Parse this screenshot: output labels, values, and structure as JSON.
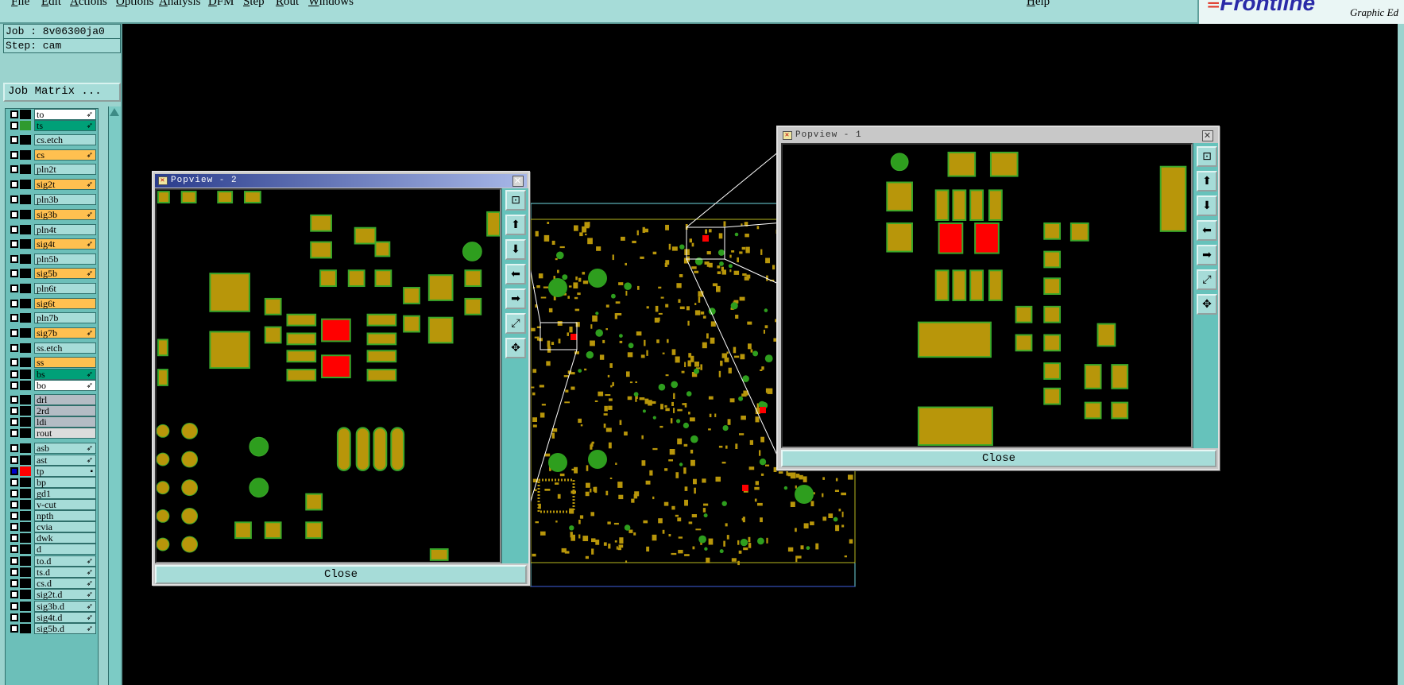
{
  "menu": [
    "File",
    "Edit",
    "Actions",
    "Options",
    "Analysis",
    "DFM",
    "Step",
    "Rout",
    "Windows"
  ],
  "menu_help": "Help",
  "logo": {
    "text": "Frontline",
    "sub": "Graphic Ed"
  },
  "job": {
    "job_line": "Job : 8v06300ja0",
    "step_line": "Step: cam"
  },
  "job_matrix_label": "Job Matrix ...",
  "layers": [
    {
      "name": "to",
      "color": "#ffffff",
      "has_arrow": true
    },
    {
      "name": "ts",
      "color": "#00a078",
      "has_arrow": true
    },
    {
      "name": "cs.etch",
      "color": "#a6dcd8",
      "has_arrow": false
    },
    {
      "name": "cs",
      "color": "#ffc050",
      "has_arrow": true
    },
    {
      "name": "pln2t",
      "color": "#a6dcd8",
      "has_arrow": false
    },
    {
      "name": "sig2t",
      "color": "#ffc050",
      "has_arrow": true
    },
    {
      "name": "pln3b",
      "color": "#a6dcd8",
      "has_arrow": false
    },
    {
      "name": "sig3b",
      "color": "#ffc050",
      "has_arrow": true
    },
    {
      "name": "pln4t",
      "color": "#a6dcd8",
      "has_arrow": false
    },
    {
      "name": "sig4t",
      "color": "#ffc050",
      "has_arrow": true
    },
    {
      "name": "pln5b",
      "color": "#a6dcd8",
      "has_arrow": false
    },
    {
      "name": "sig5b",
      "color": "#ffc050",
      "has_arrow": true
    },
    {
      "name": "pln6t",
      "color": "#a6dcd8",
      "has_arrow": false
    },
    {
      "name": "sig6t",
      "color": "#ffc050",
      "has_arrow": false
    },
    {
      "name": "pln7b",
      "color": "#a6dcd8",
      "has_arrow": false
    },
    {
      "name": "sig7b",
      "color": "#ffc050",
      "has_arrow": true
    },
    {
      "name": "ss.etch",
      "color": "#a6dcd8",
      "has_arrow": false
    },
    {
      "name": "ss",
      "color": "#ffc050",
      "has_arrow": false
    },
    {
      "name": "bs",
      "color": "#00a078",
      "has_arrow": true
    },
    {
      "name": "bo",
      "color": "#ffffff",
      "has_arrow": true
    },
    {
      "name": "drl",
      "color": "#b4bcc4",
      "has_arrow": false
    },
    {
      "name": "2rd",
      "color": "#b4bcc4",
      "has_arrow": false
    },
    {
      "name": "ldi",
      "color": "#b4bcc4",
      "has_arrow": false
    },
    {
      "name": "rout",
      "color": "#dcdcdc",
      "has_arrow": false
    },
    {
      "name": "asb",
      "color": "#a6dcd8",
      "has_arrow": true
    },
    {
      "name": "ast",
      "color": "#a6dcd8",
      "has_arrow": true
    },
    {
      "name": "tp",
      "color": "#a6dcd8",
      "has_arrow": true,
      "active": true
    },
    {
      "name": "bp",
      "color": "#a6dcd8",
      "has_arrow": false
    },
    {
      "name": "gd1",
      "color": "#a6dcd8",
      "has_arrow": false
    },
    {
      "name": "v-cut",
      "color": "#a6dcd8",
      "has_arrow": false
    },
    {
      "name": "npth",
      "color": "#a6dcd8",
      "has_arrow": false
    },
    {
      "name": "cvia",
      "color": "#a6dcd8",
      "has_arrow": false
    },
    {
      "name": "dwk",
      "color": "#a6dcd8",
      "has_arrow": false
    },
    {
      "name": "d",
      "color": "#a6dcd8",
      "has_arrow": false
    },
    {
      "name": "to.d",
      "color": "#a6dcd8",
      "has_arrow": true
    },
    {
      "name": "ts.d",
      "color": "#a6dcd8",
      "has_arrow": true
    },
    {
      "name": "cs.d",
      "color": "#a6dcd8",
      "has_arrow": true
    },
    {
      "name": "sig2t.d",
      "color": "#a6dcd8",
      "has_arrow": true
    },
    {
      "name": "sig3b.d",
      "color": "#a6dcd8",
      "has_arrow": true
    },
    {
      "name": "sig4t.d",
      "color": "#a6dcd8",
      "has_arrow": true
    },
    {
      "name": "sig5b.d",
      "color": "#a6dcd8",
      "has_arrow": true
    }
  ],
  "popview2": {
    "title": "Popview - 2",
    "close": "Close"
  },
  "popview1": {
    "title": "Popview - 1",
    "close": "Close"
  },
  "colors": {
    "pad": "#b8960a",
    "pad_edge": "#3aa82a",
    "green": "#2e9e1e",
    "red": "#ff0000",
    "panel": "#a6dcd8"
  }
}
